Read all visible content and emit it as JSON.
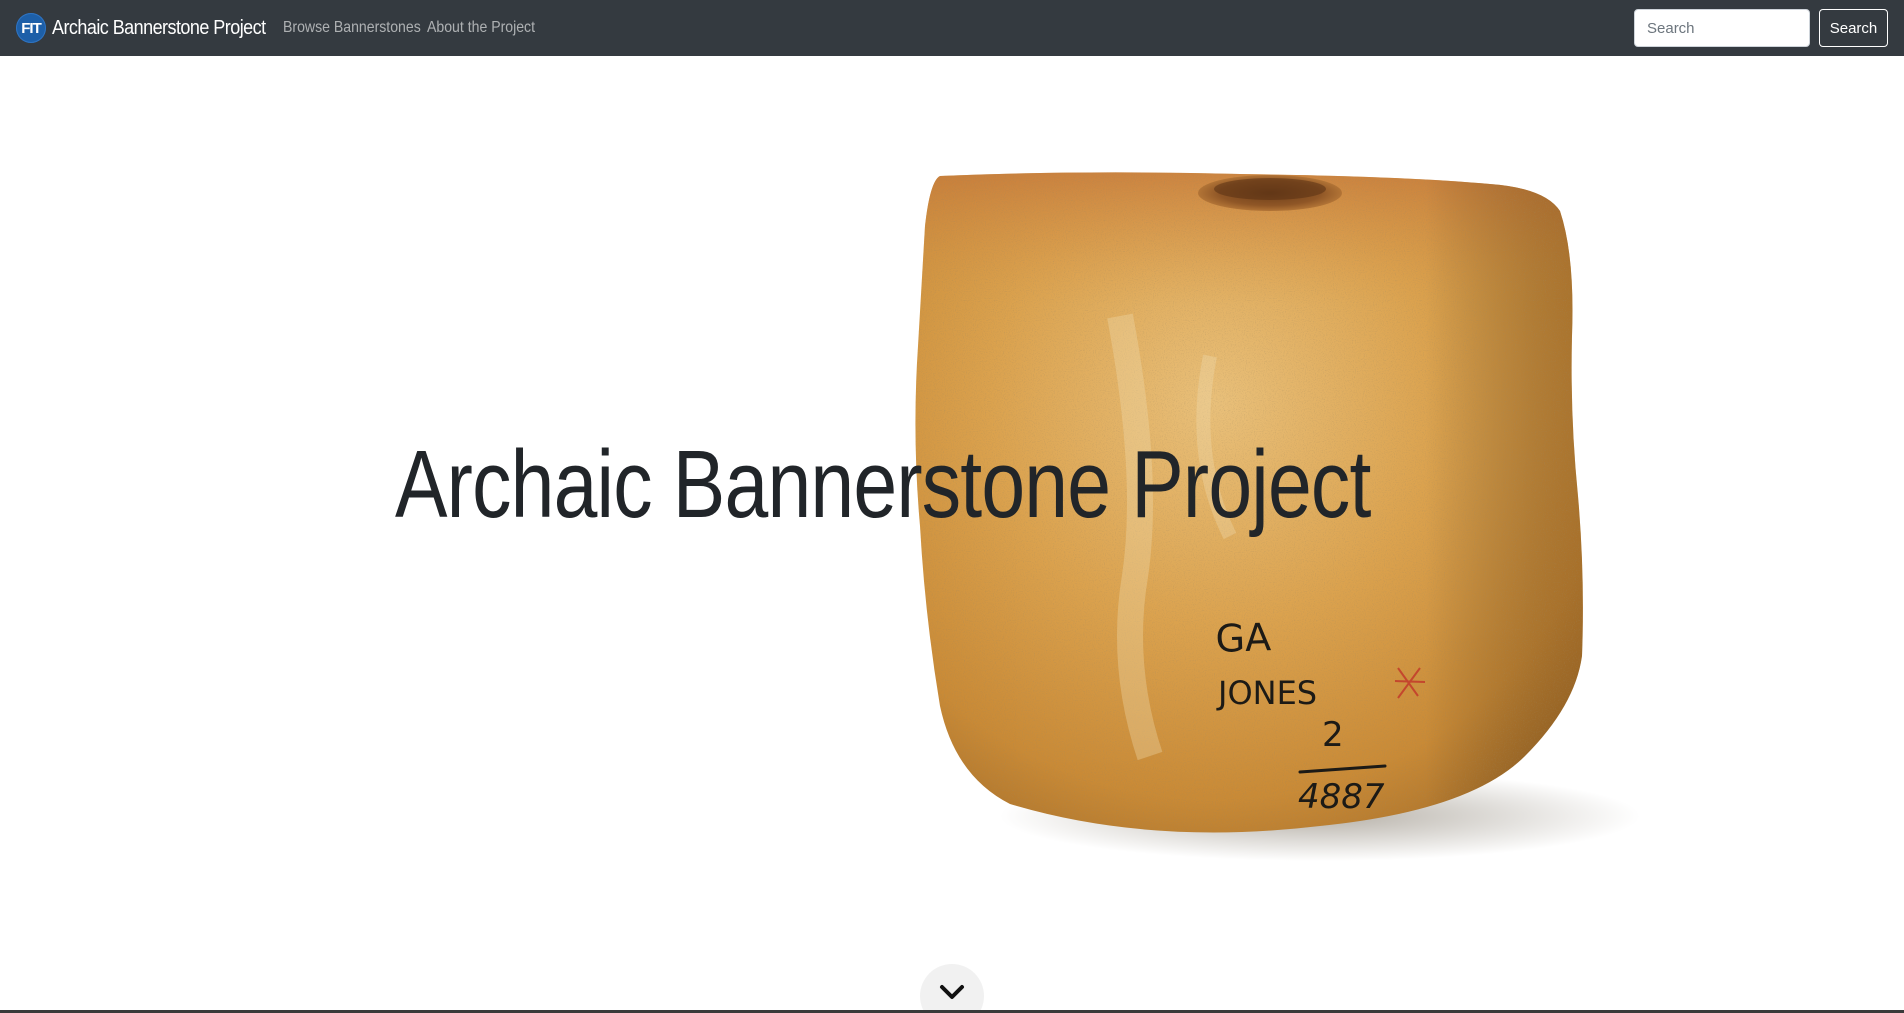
{
  "navbar": {
    "logo_text": "FIT",
    "brand": "Archaic Bannerstone Project",
    "links": [
      {
        "label": "Browse Bannerstones"
      },
      {
        "label": "About the Project"
      }
    ],
    "search_placeholder": "Search",
    "search_button": "Search"
  },
  "hero": {
    "title": "Archaic Bannerstone Project",
    "image_icon": "bannerstone-photo",
    "artifact_marking_lines": [
      "GA",
      "JONES",
      "2",
      "4887"
    ],
    "scroll_icon": "chevron-down-icon"
  },
  "colors": {
    "navbar_bg": "#343a40",
    "logo_bg": "#1d5fa8",
    "stone_main": "#d9a24c",
    "title_text": "#212529"
  }
}
